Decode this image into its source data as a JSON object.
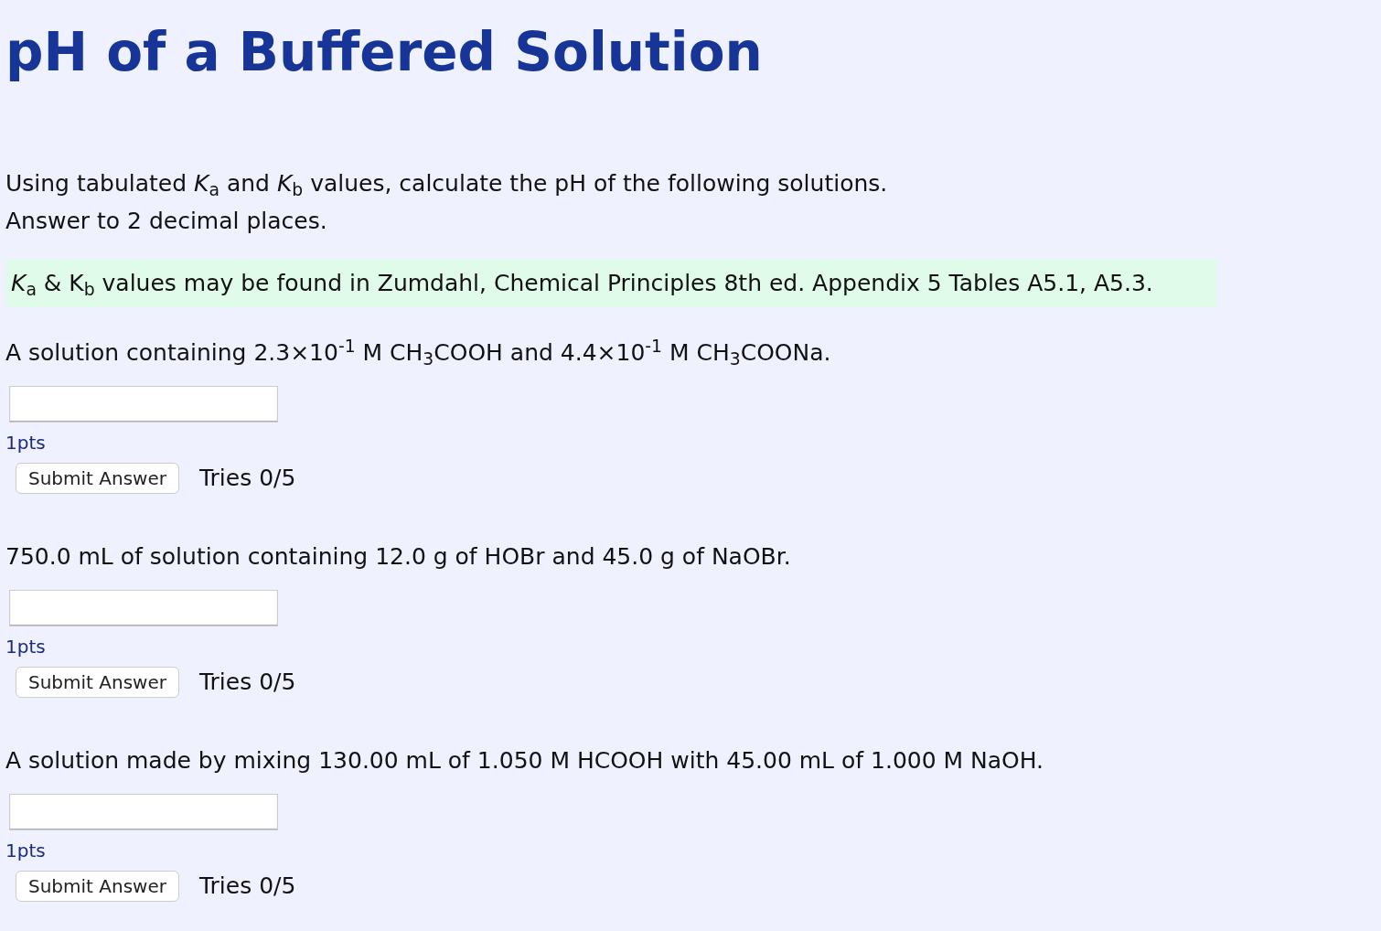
{
  "title": "pH of a Buffered Solution",
  "intro": [
    "Using tabulated *K*$_{a}$ and *K*$_{b}$ values, calculate the pH of the following solutions.",
    "Answer to 2 decimal places."
  ],
  "note": "*K*$_{a}$ & K$_{b}$ values may be found in Zumdahl, Chemical Principles 8th ed. Appendix 5 Tables A5.1, A5.3.",
  "questions": [
    {
      "text": "A solution containing 2.3×10$^{-1}$ M CH$_{3}$COOH and 4.4×10$^{-1}$ M CH$_{3}$COONa.",
      "points": "1pts",
      "button": "Submit Answer",
      "tries": "Tries 0/5"
    },
    {
      "text": "750.0 mL of solution containing 12.0 g of HOBr and 45.0 g of NaOBr.",
      "points": "1pts",
      "button": "Submit Answer",
      "tries": "Tries 0/5"
    },
    {
      "text": "A solution made by mixing 130.00 mL of 1.050 M HCOOH with 45.00 mL of 1.000 M NaOH.",
      "points": "1pts",
      "button": "Submit Answer",
      "tries": "Tries 0/5"
    }
  ]
}
